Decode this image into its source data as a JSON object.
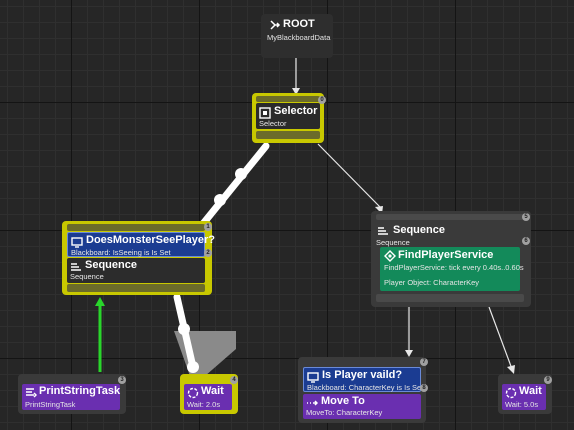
{
  "root": {
    "title": "ROOT",
    "subtitle": "MyBlackboardData"
  },
  "selector": {
    "title": "Selector",
    "subtitle": "Selector",
    "index": "0"
  },
  "left_sequence": {
    "index": "1",
    "decorator": {
      "title": "DoesMonsterSeePlayer?",
      "subtitle": "Blackboard: IsSeeing is Is Set",
      "index": "2"
    },
    "title": "Sequence",
    "subtitle": "Sequence"
  },
  "right_sequence": {
    "index": "5",
    "title": "Sequence",
    "subtitle": "Sequence",
    "service": {
      "index": "6",
      "title": "FindPlayerService",
      "line1": "FindPlayerService: tick every 0.40s..0.60s",
      "line2": "Player Object: CharacterKey"
    }
  },
  "print_task": {
    "title": "PrintStringTask",
    "subtitle": "PrintStringTask",
    "index": "3"
  },
  "wait_left": {
    "title": "Wait",
    "subtitle": "Wait: 2.0s",
    "index": "4"
  },
  "moveto_group": {
    "index": "7",
    "decorator": {
      "title": "Is Player vaild?",
      "subtitle": "Blackboard: CharacterKey is Is Set",
      "index": "8"
    },
    "task": {
      "title": "Move To",
      "subtitle": "MoveTo: CharacterKey"
    }
  },
  "wait_right": {
    "title": "Wait",
    "subtitle": "Wait: 5.0s",
    "index": "9"
  }
}
